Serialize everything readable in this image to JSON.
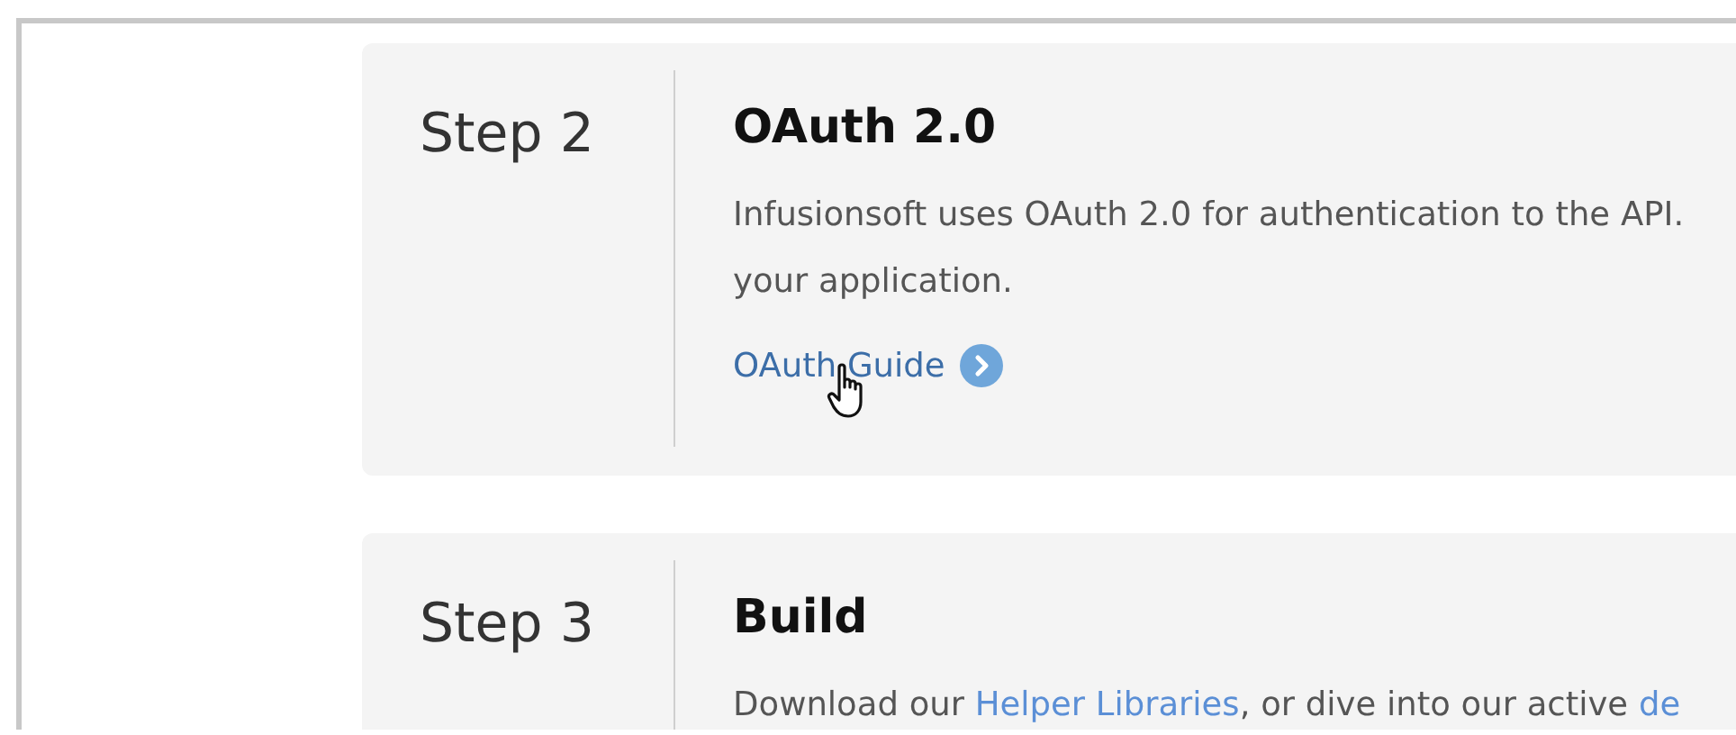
{
  "steps": [
    {
      "step": "Step 2",
      "title": "OAuth 2.0",
      "lines": [
        [
          {
            "text": "Infusionsoft uses OAuth 2.0 for authentication to the API.",
            "link": false
          }
        ],
        [
          {
            "text": "your application.",
            "link": false
          }
        ]
      ],
      "action": {
        "label": "OAuth Guide"
      }
    },
    {
      "step": "Step 3",
      "title": "Build",
      "lines": [
        [
          {
            "text": "Download our ",
            "link": false
          },
          {
            "text": "Helper Libraries",
            "link": true
          },
          {
            "text": ", or dive into our active ",
            "link": false
          },
          {
            "text": "de",
            "link": true
          }
        ]
      ]
    }
  ]
}
